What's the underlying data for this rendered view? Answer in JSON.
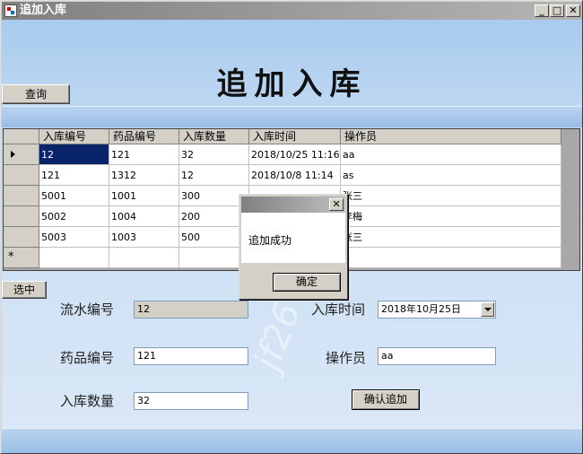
{
  "window": {
    "title": "追加入库"
  },
  "banner": {
    "title": "追加入库"
  },
  "toolbar": {
    "query_label": "查询",
    "select_label": "选中",
    "confirm_add_label": "确认追加"
  },
  "grid": {
    "columns": [
      "入库编号",
      "药品编号",
      "入库数量",
      "入库时间",
      "操作员"
    ],
    "rows": [
      [
        "12",
        "121",
        "32",
        "2018/10/25 11:16",
        "aa"
      ],
      [
        "121",
        "1312",
        "12",
        "2018/10/8 11:14",
        "as"
      ],
      [
        "5001",
        "1001",
        "300",
        "",
        "张三"
      ],
      [
        "5002",
        "1004",
        "200",
        "",
        "李梅"
      ],
      [
        "5003",
        "1003",
        "500",
        "",
        "张三"
      ]
    ],
    "new_row_marker": "*"
  },
  "form": {
    "serial_label": "流水编号",
    "serial_value": "12",
    "drug_label": "药品编号",
    "drug_value": "121",
    "qty_label": "入库数量",
    "qty_value": "32",
    "time_label": "入库时间",
    "time_value": "2018年10月25日",
    "operator_label": "操作员",
    "operator_value": "aa"
  },
  "dialog": {
    "close_glyph": "✕",
    "message": "追加成功",
    "ok_label": "确定"
  },
  "watermark": "jf26",
  "icons": {
    "window": "app-icon",
    "minimize": "minimize-icon",
    "maximize": "maximize-icon",
    "close": "close-icon"
  }
}
